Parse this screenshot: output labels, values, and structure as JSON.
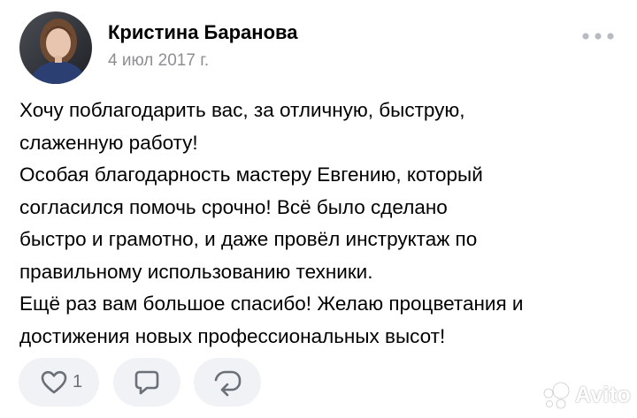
{
  "post": {
    "author": {
      "name": "Кристина Баранова",
      "avatar_icon": "avatar-photo"
    },
    "date": "4 июл 2017 г.",
    "more_icon": "more-horizontal-icon",
    "body_lines": [
      "Хочу поблагодарить вас, за отличную, быструю,",
      "слаженную работу!",
      "Особая благодарность мастеру Евгению, который",
      "согласился помочь срочно! Всё было сделано",
      "быстро и грамотно, и даже провёл инструктаж по",
      "правильному использованию техники.",
      "Ещё раз вам большое спасибо! Желаю процветания и",
      "достижения новых профессиональных высот!"
    ]
  },
  "actions": {
    "like": {
      "icon": "heart-icon",
      "count": "1"
    },
    "comment": {
      "icon": "comment-icon"
    },
    "share": {
      "icon": "share-icon"
    }
  },
  "watermark": {
    "text": "Avito"
  },
  "colors": {
    "text": "#000000",
    "secondary_text": "#8e8e93",
    "action_background": "#f0f2f5",
    "action_icon": "#6b7078",
    "more_dots": "#b8bcc2"
  }
}
